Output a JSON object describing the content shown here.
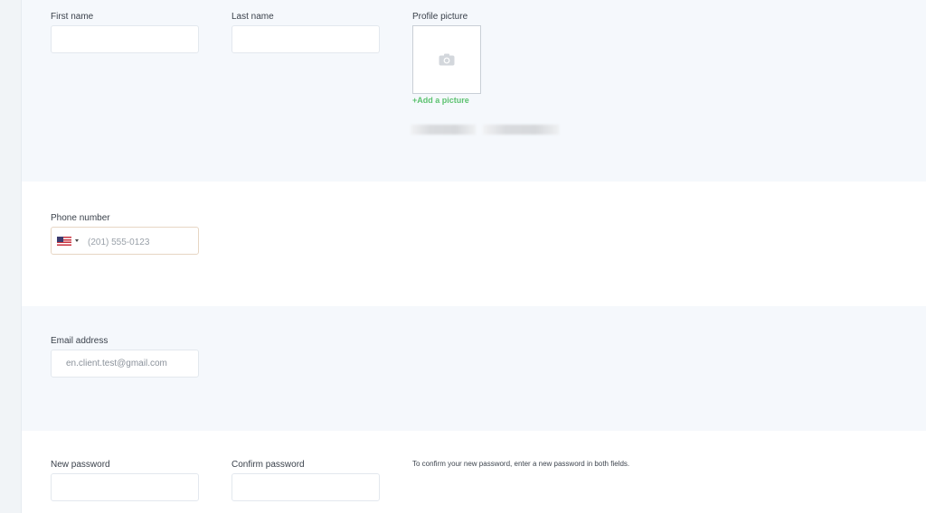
{
  "name_section": {
    "first_name_label": "First name",
    "first_name_value": "",
    "last_name_label": "Last name",
    "last_name_value": "",
    "profile_picture_label": "Profile picture",
    "add_picture_label": "+Add a picture",
    "icon": "camera-icon"
  },
  "phone_section": {
    "label": "Phone number",
    "country_flag": "us-flag-icon",
    "placeholder": "(201) 555-0123",
    "value": ""
  },
  "email_section": {
    "label": "Email address",
    "value": "en.client.test@gmail.com"
  },
  "password_section": {
    "new_password_label": "New password",
    "confirm_password_label": "Confirm password",
    "help_text": "To confirm your new password, enter a new password in both fields."
  },
  "colors": {
    "accent_green": "#5cc26f",
    "section_alt_bg": "#f5f8fc",
    "section_bg": "#ffffff"
  }
}
